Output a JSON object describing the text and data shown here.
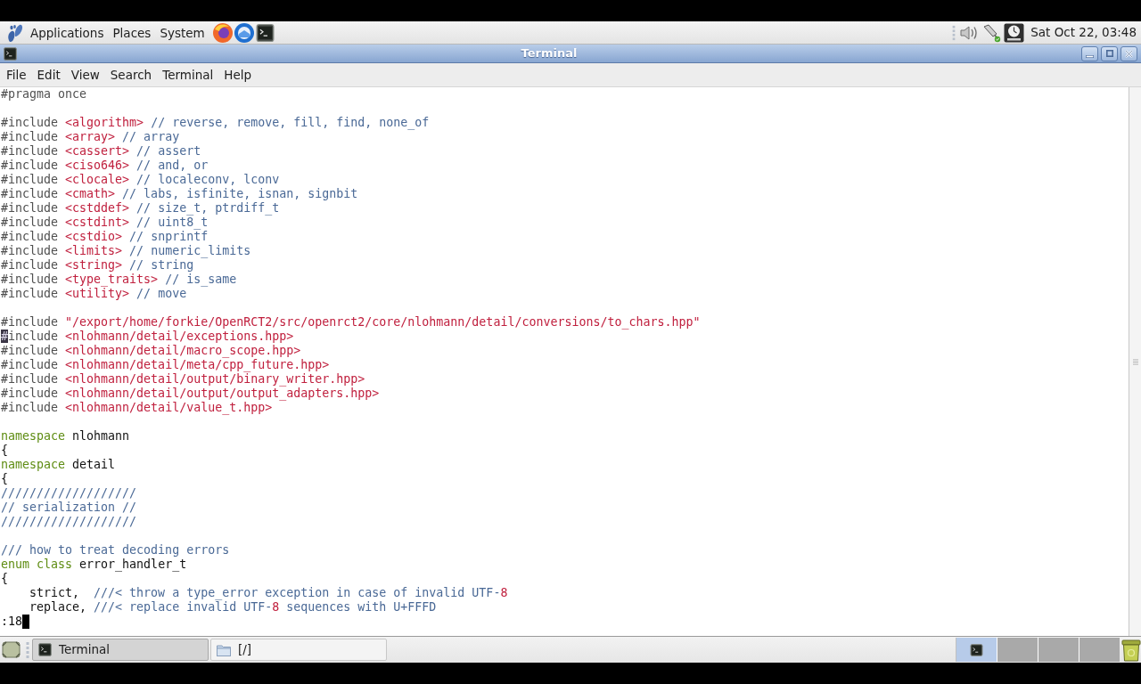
{
  "top_panel": {
    "menus": [
      "Applications",
      "Places",
      "System"
    ],
    "clock": "Sat Oct 22, 03:48"
  },
  "window": {
    "title": "Terminal"
  },
  "menu_bar": [
    "File",
    "Edit",
    "View",
    "Search",
    "Terminal",
    "Help"
  ],
  "terminal": {
    "blocks": [
      [
        [
          {
            "text": "#pragma once",
            "kind": "preproc"
          }
        ]
      ],
      [
        [
          {
            "text": "#include",
            "kind": "preproc"
          },
          {
            "text": " <algorithm>",
            "kind": "string"
          },
          {
            "text": " // reverse, remove, fill, find, none_of",
            "kind": "comment"
          }
        ],
        [
          {
            "text": "#include",
            "kind": "preproc"
          },
          {
            "text": " <array>",
            "kind": "string"
          },
          {
            "text": " // array",
            "kind": "comment"
          }
        ],
        [
          {
            "text": "#include",
            "kind": "preproc"
          },
          {
            "text": " <cassert>",
            "kind": "string"
          },
          {
            "text": " // assert",
            "kind": "comment"
          }
        ],
        [
          {
            "text": "#include",
            "kind": "preproc"
          },
          {
            "text": " <ciso646>",
            "kind": "string"
          },
          {
            "text": " // and, or",
            "kind": "comment"
          }
        ],
        [
          {
            "text": "#include",
            "kind": "preproc"
          },
          {
            "text": " <clocale>",
            "kind": "string"
          },
          {
            "text": " // localeconv, lconv",
            "kind": "comment"
          }
        ],
        [
          {
            "text": "#include",
            "kind": "preproc"
          },
          {
            "text": " <cmath>",
            "kind": "string"
          },
          {
            "text": " // labs, isfinite, isnan, signbit",
            "kind": "comment"
          }
        ],
        [
          {
            "text": "#include",
            "kind": "preproc"
          },
          {
            "text": " <cstddef>",
            "kind": "string"
          },
          {
            "text": " // size_t, ptrdiff_t",
            "kind": "comment"
          }
        ],
        [
          {
            "text": "#include",
            "kind": "preproc"
          },
          {
            "text": " <cstdint>",
            "kind": "string"
          },
          {
            "text": " // uint8_t",
            "kind": "comment"
          }
        ],
        [
          {
            "text": "#include",
            "kind": "preproc"
          },
          {
            "text": " <cstdio>",
            "kind": "string"
          },
          {
            "text": " // snprintf",
            "kind": "comment"
          }
        ],
        [
          {
            "text": "#include",
            "kind": "preproc"
          },
          {
            "text": " <limits>",
            "kind": "string"
          },
          {
            "text": " // numeric_limits",
            "kind": "comment"
          }
        ],
        [
          {
            "text": "#include",
            "kind": "preproc"
          },
          {
            "text": " <string>",
            "kind": "string"
          },
          {
            "text": " // string",
            "kind": "comment"
          }
        ],
        [
          {
            "text": "#include",
            "kind": "preproc"
          },
          {
            "text": " <type_traits>",
            "kind": "string"
          },
          {
            "text": " // is_same",
            "kind": "comment"
          }
        ],
        [
          {
            "text": "#include",
            "kind": "preproc"
          },
          {
            "text": " <utility>",
            "kind": "string"
          },
          {
            "text": " // move",
            "kind": "comment"
          }
        ]
      ],
      [
        [
          {
            "text": "#include",
            "kind": "preproc"
          },
          {
            "text": " \"/export/home/forkie/OpenRCT2/src/openrct2/core/nlohmann/detail/conversions/to_chars.hpp\"",
            "kind": "string"
          }
        ],
        [
          {
            "text": "#",
            "kind": "cursor"
          },
          {
            "text": "include",
            "kind": "preproc"
          },
          {
            "text": " <nlohmann/detail/exceptions.hpp>",
            "kind": "string"
          }
        ],
        [
          {
            "text": "#include",
            "kind": "preproc"
          },
          {
            "text": " <nlohmann/detail/macro_scope.hpp>",
            "kind": "string"
          }
        ],
        [
          {
            "text": "#include",
            "kind": "preproc"
          },
          {
            "text": " <nlohmann/detail/meta/cpp_future.hpp>",
            "kind": "string"
          }
        ],
        [
          {
            "text": "#include",
            "kind": "preproc"
          },
          {
            "text": " <nlohmann/detail/output/binary_writer.hpp>",
            "kind": "string"
          }
        ],
        [
          {
            "text": "#include",
            "kind": "preproc"
          },
          {
            "text": " <nlohmann/detail/output/output_adapters.hpp>",
            "kind": "string"
          }
        ],
        [
          {
            "text": "#include",
            "kind": "preproc"
          },
          {
            "text": " <nlohmann/detail/value_t.hpp>",
            "kind": "string"
          }
        ]
      ],
      [
        [
          {
            "text": "namespace",
            "kind": "keyword"
          },
          {
            "text": " nlohmann",
            "kind": "plain"
          }
        ],
        [
          {
            "text": "{",
            "kind": "plain"
          }
        ],
        [
          {
            "text": "namespace",
            "kind": "keyword"
          },
          {
            "text": " detail",
            "kind": "plain"
          }
        ],
        [
          {
            "text": "{",
            "kind": "plain"
          }
        ],
        [
          {
            "text": "///////////////////",
            "kind": "comment"
          }
        ],
        [
          {
            "text": "// serialization //",
            "kind": "comment"
          }
        ],
        [
          {
            "text": "///////////////////",
            "kind": "comment"
          }
        ]
      ],
      [
        [
          {
            "text": "/// how to treat decoding errors",
            "kind": "comment"
          }
        ],
        [
          {
            "text": "enum class",
            "kind": "keyword"
          },
          {
            "text": " error_handler_t",
            "kind": "plain"
          }
        ],
        [
          {
            "text": "{",
            "kind": "plain"
          }
        ],
        [
          {
            "text": "    strict,",
            "kind": "plain"
          },
          {
            "text": "  ///< throw a type_error exception in case of invalid UTF-",
            "kind": "comment"
          },
          {
            "text": "8",
            "kind": "number"
          }
        ],
        [
          {
            "text": "    replace,",
            "kind": "plain"
          },
          {
            "text": " ///< replace invalid UTF-",
            "kind": "comment"
          },
          {
            "text": "8",
            "kind": "number"
          },
          {
            "text": " sequences with U+FFFD",
            "kind": "comment"
          }
        ]
      ]
    ],
    "command_line": {
      "text": ":18",
      "cursor": true
    }
  },
  "taskbar": {
    "tasks": [
      {
        "label": "Terminal",
        "kind": "terminal",
        "selected": true
      },
      {
        "label": "[/]",
        "kind": "folder",
        "selected": false
      }
    ],
    "workspaces": [
      {
        "selected": true,
        "windows": [
          {
            "kind": "terminal"
          }
        ]
      },
      {
        "selected": false
      },
      {
        "selected": false
      },
      {
        "selected": false
      }
    ]
  }
}
